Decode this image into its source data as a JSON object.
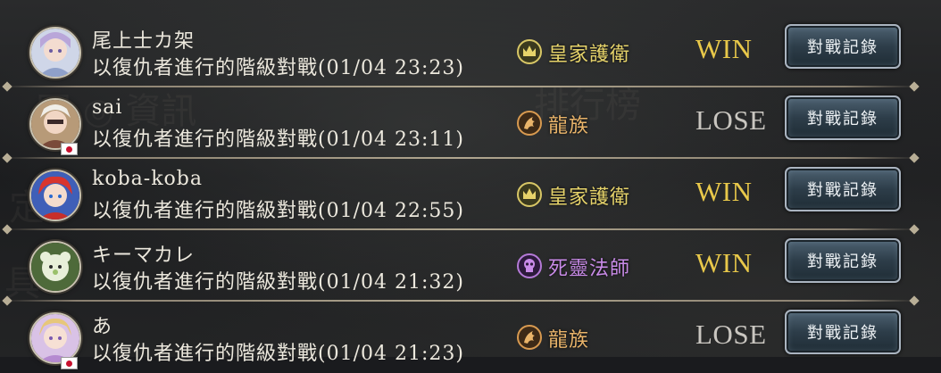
{
  "colors": {
    "win": "#e8c84a",
    "lose": "#c9c6c0",
    "royal_guard": "#e6d36a",
    "dragon": "#e9b46a",
    "necromancer": "#c98be8"
  },
  "records": [
    {
      "player_name": "尾上士カ架",
      "description": "以復仇者進行的階級對戰(01/04 23:23)",
      "opponent_class": "皇家護衛",
      "class_icon": "crown-icon",
      "class_color": "#e6d36a",
      "result": "WIN",
      "result_color": "#e8c84a",
      "has_flag": false,
      "button_label": "對戰記錄"
    },
    {
      "player_name": "sai",
      "description": "以復仇者進行的階級對戰(01/04 23:11)",
      "opponent_class": "龍族",
      "class_icon": "dragon-icon",
      "class_color": "#e9b46a",
      "result": "LOSE",
      "result_color": "#c9c6c0",
      "has_flag": true,
      "button_label": "對戰記錄"
    },
    {
      "player_name": "koba-koba",
      "description": "以復仇者進行的階級對戰(01/04 22:55)",
      "opponent_class": "皇家護衛",
      "class_icon": "crown-icon",
      "class_color": "#e6d36a",
      "result": "WIN",
      "result_color": "#e8c84a",
      "has_flag": false,
      "button_label": "對戰記錄"
    },
    {
      "player_name": "キーマカレ",
      "description": "以復仇者進行的階級對戰(01/04 21:32)",
      "opponent_class": "死靈法師",
      "class_icon": "skull-icon",
      "class_color": "#c98be8",
      "result": "WIN",
      "result_color": "#e8c84a",
      "has_flag": false,
      "button_label": "對戰記錄"
    },
    {
      "player_name": "あ",
      "description": "以復仇者進行的階級對戰(01/04 21:23)",
      "opponent_class": "龍族",
      "class_icon": "dragon-icon",
      "class_color": "#e9b46a",
      "result": "LOSE",
      "result_color": "#c9c6c0",
      "has_flag": true,
      "button_label": "對戰記錄"
    }
  ]
}
